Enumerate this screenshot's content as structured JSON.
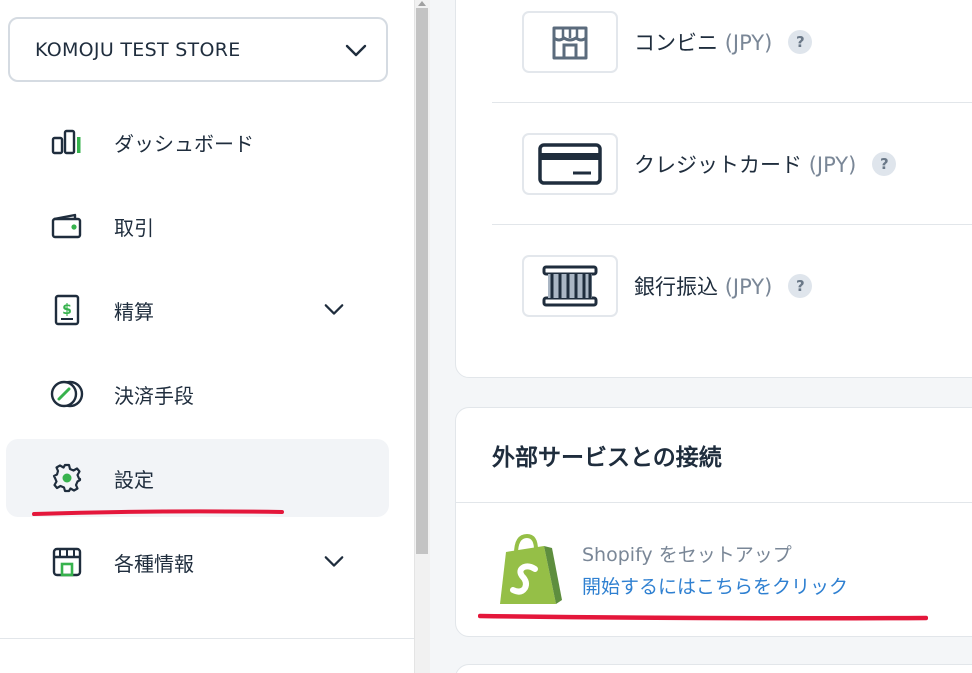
{
  "store": {
    "name": "KOMOJU TEST STORE"
  },
  "nav": {
    "items": [
      {
        "label": "ダッシュボード",
        "icon": "bar-chart-icon"
      },
      {
        "label": "取引",
        "icon": "wallet-icon"
      },
      {
        "label": "精算",
        "icon": "payout-icon",
        "expandable": true
      },
      {
        "label": "決済手段",
        "icon": "payment-method-icon"
      },
      {
        "label": "設定",
        "icon": "gear-icon",
        "active": true
      },
      {
        "label": "各種情報",
        "icon": "store-info-icon",
        "expandable": true
      }
    ]
  },
  "payment_methods": [
    {
      "name": "コンビニ",
      "currency": "(JPY)",
      "icon": "store-icon",
      "help": "?"
    },
    {
      "name": "クレジットカード",
      "currency": "(JPY)",
      "icon": "credit-card-icon",
      "help": "?"
    },
    {
      "name": "銀行振込",
      "currency": "(JPY)",
      "icon": "bank-icon",
      "help": "?"
    }
  ],
  "services": {
    "title": "外部サービスとの接続",
    "shopify": {
      "title": "Shopify をセットアップ",
      "link": "開始するにはこちらをクリック"
    }
  },
  "colors": {
    "accent_green": "#37b24d",
    "link_blue": "#2f80d1",
    "annotation_red": "#e4173b",
    "shopify_green": "#95bf47"
  }
}
